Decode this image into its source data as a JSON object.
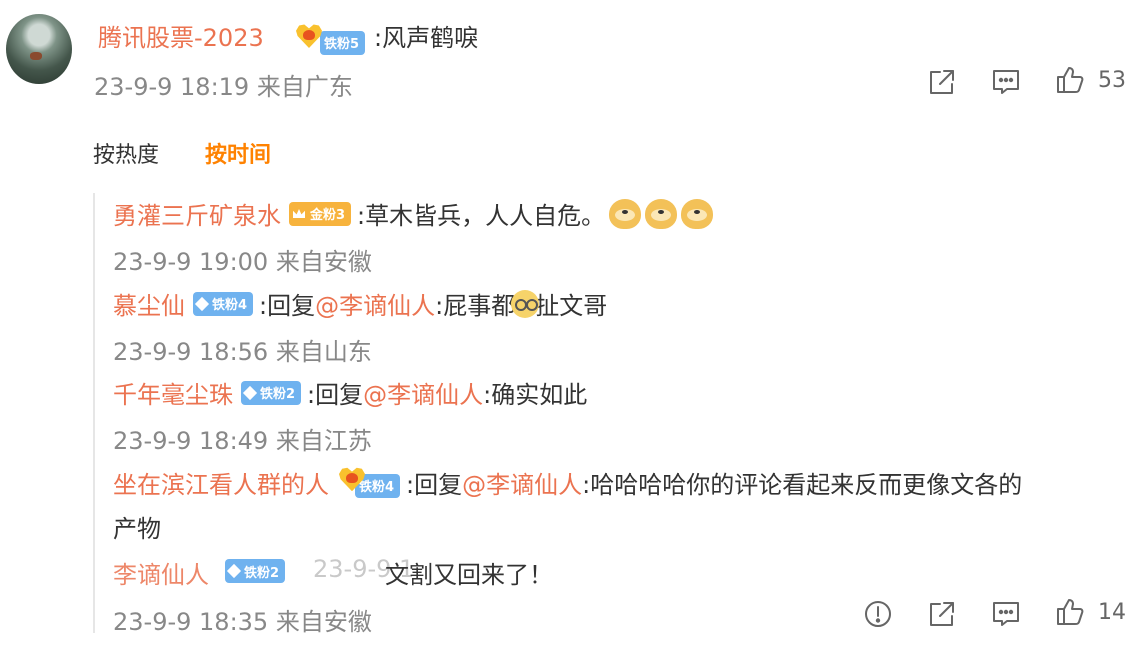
{
  "main_comment": {
    "username": "腾讯股票-2023",
    "badge": "铁粉5",
    "text": ":风声鹤唳",
    "time": "23-9-9 18:19 来自广东",
    "like_count": "53",
    "icons": [
      "share-icon",
      "comment-icon",
      "like-icon"
    ]
  },
  "sort_tabs": {
    "hot": "按热度",
    "time": "按时间",
    "active": "time"
  },
  "replies": [
    {
      "username": "勇灌三斤矿泉水",
      "badge": "金粉3",
      "text": ":草木皆兵，人人自危。",
      "emoji": "dog-emoji",
      "time": "23-9-9 19:00 来自安徽"
    },
    {
      "username": "慕尘仙",
      "badge": "铁粉4",
      "reply_prefix": ":回复",
      "mention": "@李谪仙人",
      "text_before": ":屁事都",
      "emoji": "facepalm-emoji",
      "text_after": "扯文哥",
      "time": "23-9-9 18:56 来自山东"
    },
    {
      "username": "千年毫尘珠",
      "badge": "铁粉2",
      "reply_prefix": ":回复",
      "mention": "@李谪仙人",
      "text": ":确实如此",
      "time": "23-9-9 18:49 来自江苏"
    },
    {
      "username": "坐在滨江看人群的人",
      "badge": "铁粉4",
      "reply_prefix": ":回复",
      "mention": "@李谪仙人",
      "text": ":哈哈哈哈你的评论看起来反而更像文各的",
      "text_line2": "产物",
      "time": ""
    },
    {
      "username": "李谪仙人",
      "badge": "铁粉2",
      "ghost_time": "23-9-9 1",
      "text": "文割又回来了！",
      "time": "23-9-9 18:35 来自安徽",
      "like_count": "14"
    }
  ],
  "footer_icons": [
    "report-icon",
    "share-icon",
    "comment-icon",
    "like-icon"
  ],
  "colors": {
    "username": "#eb7350",
    "active_tab": "#ff8200",
    "meta": "#888888",
    "iron_badge": "#6fb2ef",
    "gold_badge": "#f7b33d"
  }
}
